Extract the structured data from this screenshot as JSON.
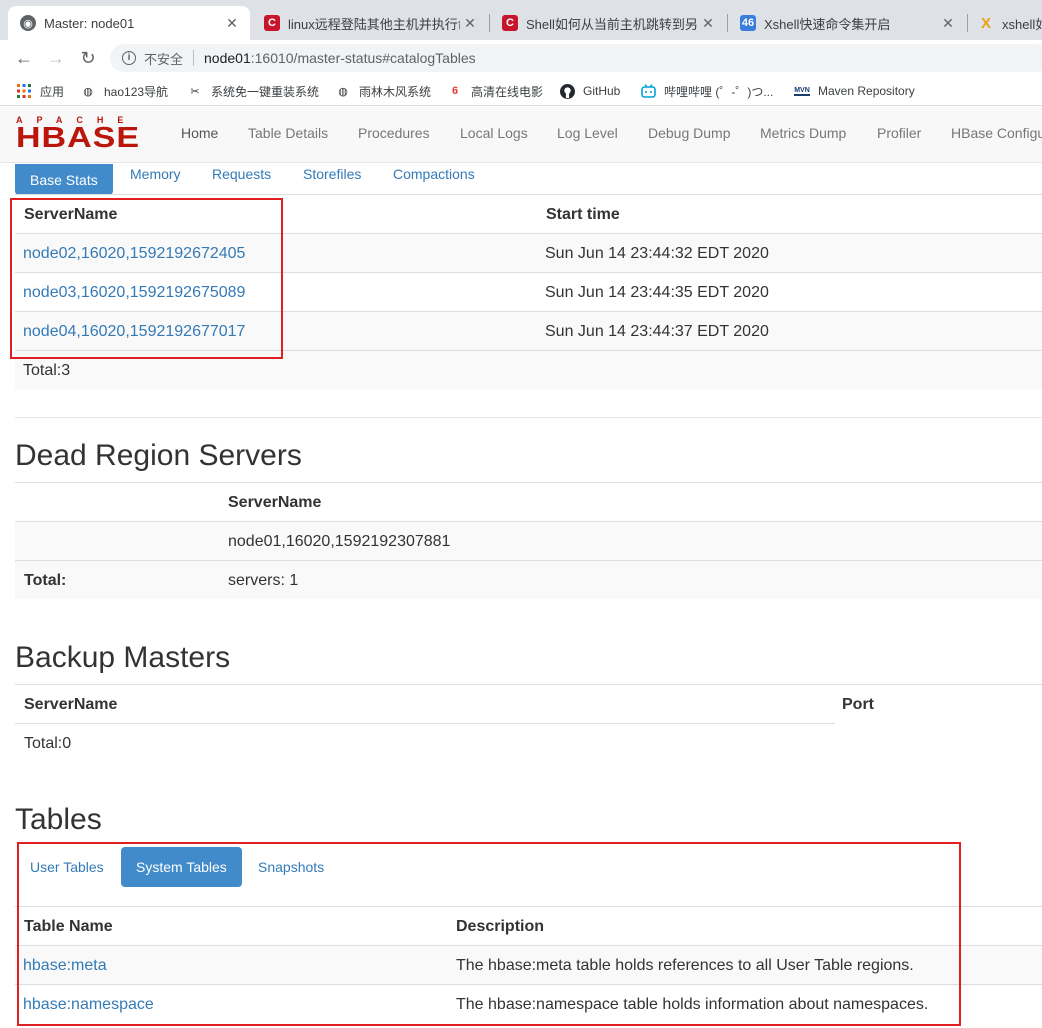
{
  "browser": {
    "tabs": [
      {
        "title": "Master: node01",
        "active": true
      },
      {
        "title": "linux远程登陆其他主机并执行命",
        "active": false
      },
      {
        "title": "Shell如何从当前主机跳转到另外",
        "active": false
      },
      {
        "title": "Xshell快速命令集开启",
        "active": false
      },
      {
        "title": "xshell如",
        "active": false
      }
    ],
    "omnibox": {
      "security_label": "不安全",
      "host": "node01",
      "path": ":16010/master-status#catalogTables"
    },
    "bookmarks": [
      {
        "label": "应用",
        "icon": "apps-grid-icon"
      },
      {
        "label": "hao123导航",
        "icon": "globe-icon"
      },
      {
        "label": "系统免一键重装系统",
        "icon": "tools-icon"
      },
      {
        "label": "雨林木风系统",
        "icon": "globe-icon"
      },
      {
        "label": "高清在线电影",
        "icon": "video-icon"
      },
      {
        "label": "GitHub",
        "icon": "github-icon"
      },
      {
        "label": "哔哩哔哩 (゜-゜)つ...",
        "icon": "bilibili-icon"
      },
      {
        "label": "Maven Repository",
        "icon": "maven-icon"
      }
    ]
  },
  "navbar": {
    "logo_top": "APACHE",
    "logo_main": "HBASE",
    "links": [
      "Home",
      "Table Details",
      "Procedures",
      "Local Logs",
      "Log Level",
      "Debug Dump",
      "Metrics Dump",
      "Profiler",
      "HBase Configu"
    ]
  },
  "region_servers": {
    "tabs": [
      "Base Stats",
      "Memory",
      "Requests",
      "Storefiles",
      "Compactions"
    ],
    "columns": [
      "ServerName",
      "Start time"
    ],
    "rows": [
      [
        "node02,16020,1592192672405",
        "Sun Jun 14 23:44:32 EDT 2020"
      ],
      [
        "node03,16020,1592192675089",
        "Sun Jun 14 23:44:35 EDT 2020"
      ],
      [
        "node04,16020,1592192677017",
        "Sun Jun 14 23:44:37 EDT 2020"
      ]
    ],
    "total": "Total:3"
  },
  "dead_region_servers": {
    "title": "Dead Region Servers",
    "column": "ServerName",
    "server": "node01,16020,1592192307881",
    "total_label": "Total:",
    "total_value": "servers: 1"
  },
  "backup_masters": {
    "title": "Backup Masters",
    "columns": [
      "ServerName",
      "Port"
    ],
    "total": "Total:0"
  },
  "tables": {
    "title": "Tables",
    "tabs": [
      "User Tables",
      "System Tables",
      "Snapshots"
    ],
    "active_tab": "System Tables",
    "columns": [
      "Table Name",
      "Description"
    ],
    "rows": [
      [
        "hbase:meta",
        "The hbase:meta table holds references to all User Table regions."
      ],
      [
        "hbase:namespace",
        "The hbase:namespace table holds information about namespaces."
      ]
    ]
  },
  "colors": {
    "link": "#337ab7",
    "active_pill": "#428bca",
    "hbase_red": "#ba160c",
    "highlight_box": "#e02020"
  }
}
